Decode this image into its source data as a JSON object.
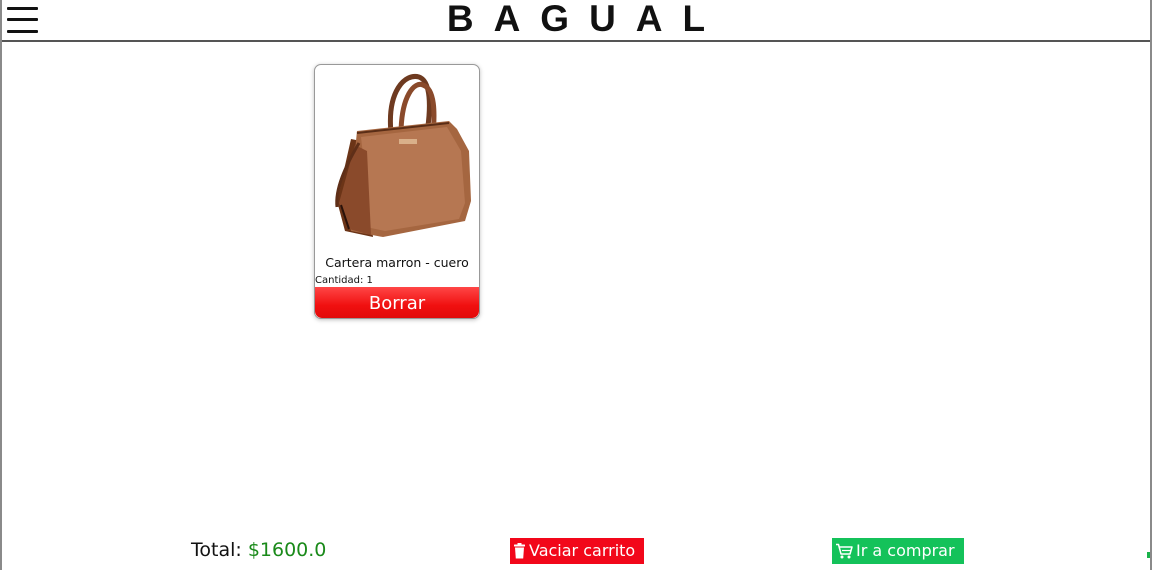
{
  "header": {
    "brand": "BAGUAL",
    "menu_icon": "hamburger-menu-icon"
  },
  "cart": {
    "items": [
      {
        "name": "Cartera marron - cuero",
        "quantity_label": "Cantidad: 1",
        "delete_label": "Borrar",
        "image_alt": "brown leather handbag"
      }
    ]
  },
  "footer": {
    "total_label": "Total: ",
    "total_value": "$1600.0",
    "empty_cart_label": "Vaciar carrito",
    "empty_cart_icon": "trash-icon",
    "checkout_label": "Ir a comprar",
    "checkout_icon": "shopping-cart-icon"
  },
  "colors": {
    "delete": "#f01010",
    "empty_cart": "#f2071a",
    "checkout": "#14c25a",
    "total_value": "#1a8a1a"
  }
}
